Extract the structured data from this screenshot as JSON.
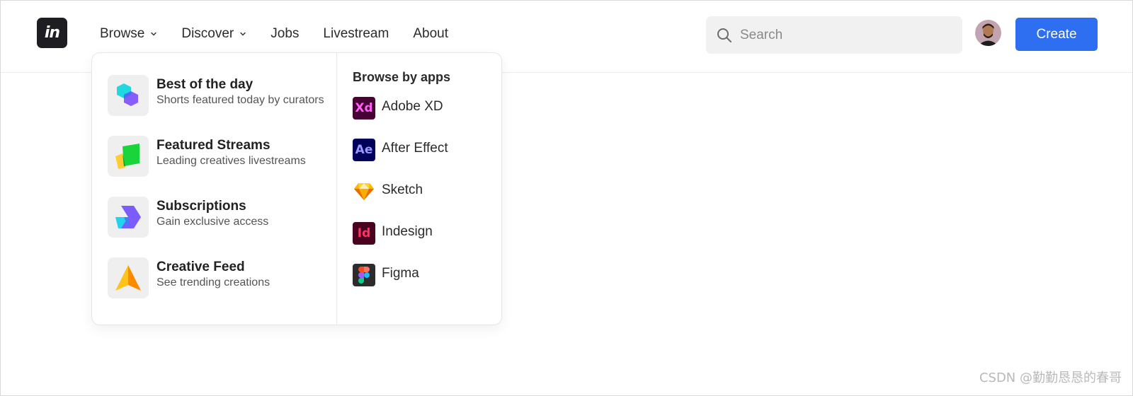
{
  "brand": {
    "logo_text": "in"
  },
  "nav": {
    "items": [
      {
        "label": "Browse",
        "has_dropdown": true
      },
      {
        "label": "Discover",
        "has_dropdown": true
      },
      {
        "label": "Jobs",
        "has_dropdown": false
      },
      {
        "label": "Livestream",
        "has_dropdown": false
      },
      {
        "label": "About",
        "has_dropdown": false
      }
    ]
  },
  "search": {
    "placeholder": "Search",
    "icon": "search-icon"
  },
  "header_actions": {
    "avatar": "user-avatar",
    "create_label": "Create"
  },
  "browse_menu": {
    "featured": [
      {
        "title": "Best of the day",
        "desc": "Shorts featured today by curators",
        "icon": "cube-icon"
      },
      {
        "title": "Featured Streams",
        "desc": "Leading creatives livestreams",
        "icon": "stream-icon"
      },
      {
        "title": "Subscriptions",
        "desc": "Gain exclusive access",
        "icon": "subscription-icon"
      },
      {
        "title": "Creative Feed",
        "desc": "See trending creations",
        "icon": "feed-icon"
      }
    ],
    "apps_heading": "Browse by apps",
    "apps": [
      {
        "name": "Adobe XD",
        "badge": "Xd",
        "bg": "#470137",
        "fg": "#ff61f6"
      },
      {
        "name": "After Effect",
        "badge": "Ae",
        "bg": "#00005b",
        "fg": "#9999ff"
      },
      {
        "name": "Sketch",
        "badge": "",
        "icon": "sketch-icon"
      },
      {
        "name": "Indesign",
        "badge": "Id",
        "bg": "#49021f",
        "fg": "#ff3366"
      },
      {
        "name": "Figma",
        "badge": "",
        "icon": "figma-icon"
      }
    ]
  },
  "colors": {
    "accent": "#2e6ff2",
    "logo_bg": "#1d1d22",
    "search_bg": "#f1f1f1"
  },
  "watermark": "CSDN @勤勤恳恳的春哥"
}
